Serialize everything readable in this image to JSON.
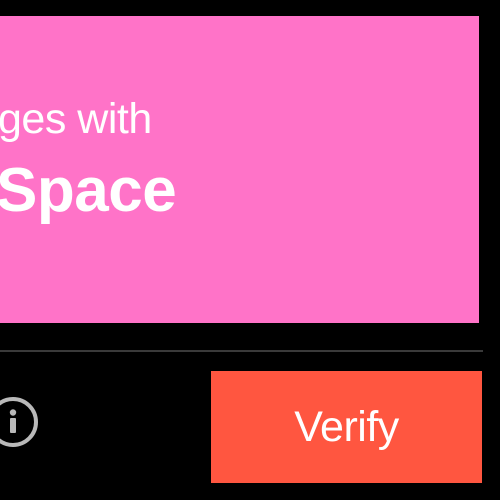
{
  "challenge": {
    "instruction": "ges with",
    "target": "Space",
    "background_color": "#ff73c8"
  },
  "footer": {
    "info_icon": "info-icon",
    "verify_label": "Verify",
    "verify_color": "#ff5640"
  }
}
